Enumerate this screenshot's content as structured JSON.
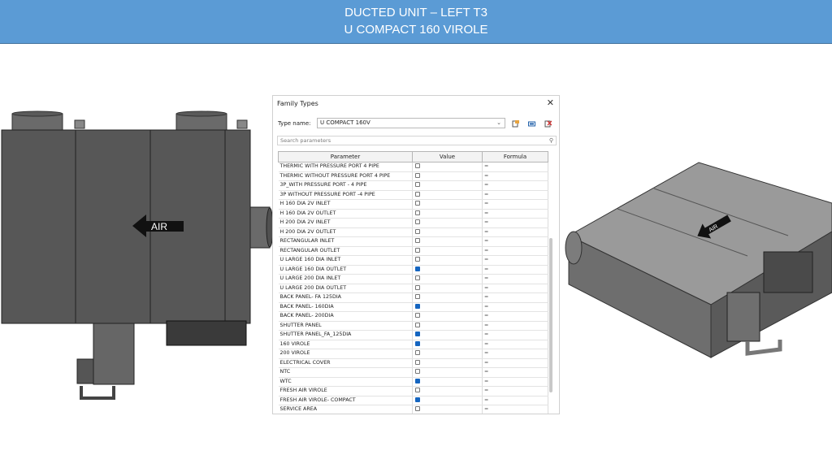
{
  "header": {
    "line1": "DUCTED UNIT – LEFT T3",
    "line2": "U COMPACT 160 VIROLE"
  },
  "front_drawing": {
    "arrow_label": "AIR"
  },
  "iso_drawing": {
    "arrow_label": "AIR"
  },
  "dialog": {
    "title": "Family Types",
    "type_name_label": "Type name:",
    "type_name_value": "U COMPACT 160V",
    "search_placeholder": "Search parameters",
    "columns": [
      "Parameter",
      "Value",
      "Formula"
    ],
    "rows": [
      {
        "name": "THERMIC WITH PRESSURE PORT 4 PIPE",
        "checked": false
      },
      {
        "name": "THERMIC WITHOUT PRESSURE PORT  4 PIPE",
        "checked": false
      },
      {
        "name": "3P_WITH PRESSURE PORT - 4 PIPE",
        "checked": false
      },
      {
        "name": "3P WITHOUT PRESSURE PORT -4  PIPE",
        "checked": false
      },
      {
        "name": "H 160 DIA 2V INLET",
        "checked": false
      },
      {
        "name": "H 160 DIA 2V OUTLET",
        "checked": false
      },
      {
        "name": "H 200 DIA 2V INLET",
        "checked": false
      },
      {
        "name": "H 200 DIA 2V OUTLET",
        "checked": false
      },
      {
        "name": "RECTANGULAR INLET",
        "checked": false
      },
      {
        "name": "RECTANGULAR  OUTLET",
        "checked": false
      },
      {
        "name": "U LARGE 160 DIA INLET",
        "checked": false
      },
      {
        "name": "U LARGE 160 DIA OUTLET",
        "checked": true
      },
      {
        "name": "U LARGE 200 DIA INLET",
        "checked": false
      },
      {
        "name": "U LARGE 200 DIA OUTLET",
        "checked": false
      },
      {
        "name": "BACK PANEL- FA 125DIA",
        "checked": false
      },
      {
        "name": "BACK PANEL- 160DIA",
        "checked": true
      },
      {
        "name": "BACK PANEL- 200DIA",
        "checked": false
      },
      {
        "name": "SHUTTER PANEL",
        "checked": false
      },
      {
        "name": "SHUTTER PANEL_FA_125DIA",
        "checked": true
      },
      {
        "name": "160 VIROLE",
        "checked": true
      },
      {
        "name": "200 VIROLE",
        "checked": false
      },
      {
        "name": "ELECTRICAL COVER",
        "checked": false
      },
      {
        "name": "NTC",
        "checked": false
      },
      {
        "name": "WTC",
        "checked": true
      },
      {
        "name": "FRESH AIR VIROLE",
        "checked": false
      },
      {
        "name": "FRESH AIR VIROLE- COMPACT",
        "checked": true
      },
      {
        "name": "SERVICE AREA",
        "checked": false
      }
    ],
    "formula_symbol": "="
  },
  "colors": {
    "header_bg": "#5b9bd5",
    "checkbox_on": "#1565c0"
  }
}
